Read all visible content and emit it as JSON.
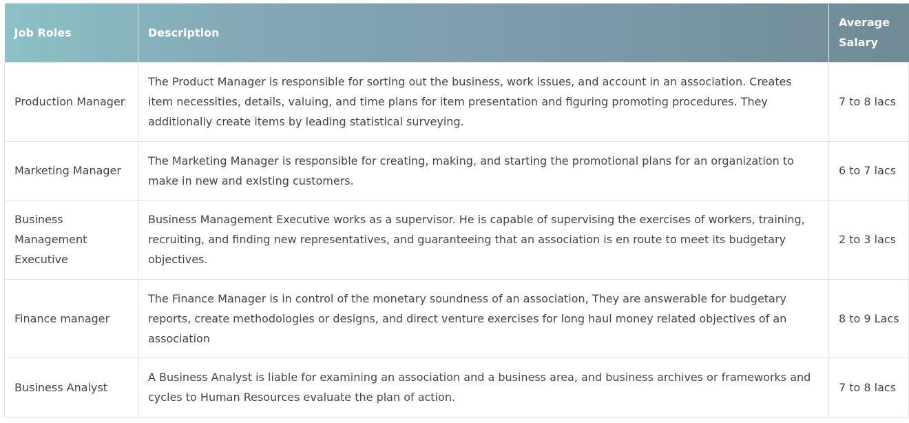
{
  "table": {
    "headers": {
      "role": "Job Roles",
      "description": "Description",
      "salary": "Average Salary"
    },
    "rows": [
      {
        "role": "Production Manager",
        "description": "The Product Manager is responsible for sorting out the business, work issues, and account in an association. Creates item necessities, details, valuing, and time plans for item presentation and figuring promoting procedures. They additionally create items by leading statistical surveying.",
        "salary": "7 to 8 lacs"
      },
      {
        "role": "Marketing Manager",
        "description": "The Marketing Manager is responsible for creating, making, and starting the promotional plans for an organization to make in new and existing customers.",
        "salary": "6 to 7 lacs"
      },
      {
        "role": "Business Management Executive",
        "description": "Business Management Executive works as a supervisor. He is capable of supervising the exercises of workers, training, recruiting, and finding new representatives, and guaranteeing that an association is en route to meet its budgetary objectives.",
        "salary": "2 to 3 lacs"
      },
      {
        "role": "Finance manager",
        "description": "The Finance Manager is in control of the monetary soundness of an association, They are answerable for budgetary reports, create methodologies or designs, and direct venture exercises for long haul money related objectives of an association",
        "salary": "8 to 9 Lacs"
      },
      {
        "role": "Business Analyst",
        "description": "A Business Analyst is liable for examining an association and a business area, and business archives or frameworks and cycles to Human Resources evaluate the plan of action.",
        "salary": "7 to 8 lacs"
      }
    ]
  }
}
